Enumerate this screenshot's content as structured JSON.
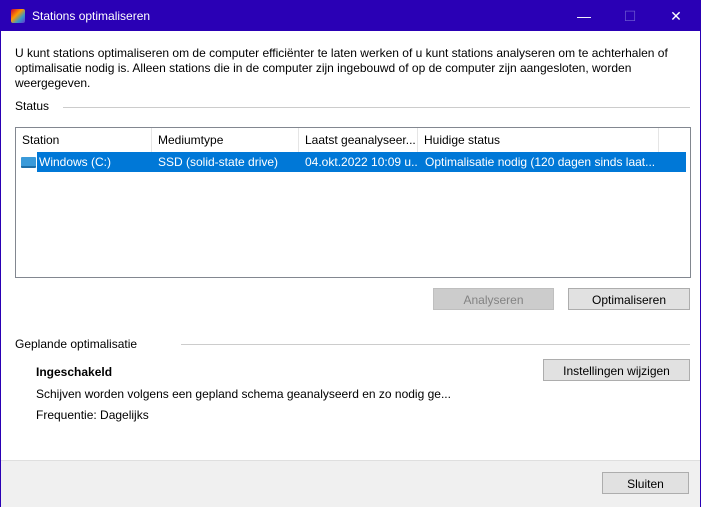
{
  "window": {
    "title": "Stations optimaliseren",
    "minimize": "—",
    "maximize": "☐",
    "close": "✕"
  },
  "description": "U kunt stations optimaliseren om de computer efficiënter te laten werken of u kunt stations analyseren om te achterhalen of optimalisatie nodig is. Alleen stations die in de computer zijn ingebouwd of op de computer zijn aangesloten, worden weergegeven.",
  "status": {
    "label": "Status",
    "columns": [
      "Station",
      "Mediumtype",
      "Laatst geanalyseer...",
      "Huidige status"
    ],
    "rows": [
      {
        "station": "Windows (C:)",
        "media": "SSD (solid-state drive)",
        "last": "04.okt.2022 10:09 u...",
        "status": "Optimalisatie nodig (120 dagen sinds laat..."
      }
    ]
  },
  "buttons": {
    "analyze": "Analyseren",
    "optimize": "Optimaliseren",
    "change_settings": "Instellingen wijzigen",
    "close": "Sluiten"
  },
  "scheduled": {
    "label": "Geplande optimalisatie",
    "state": "Ingeschakeld",
    "info": "Schijven worden volgens een gepland schema geanalyseerd en zo nodig ge...",
    "frequency": "Frequentie: Dagelijks"
  }
}
